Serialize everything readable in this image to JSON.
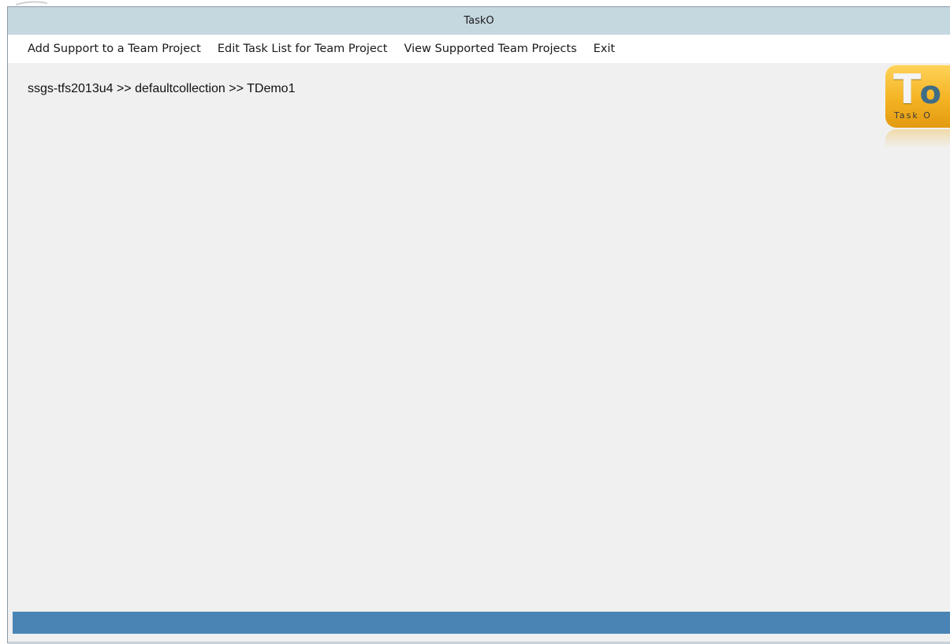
{
  "window": {
    "title": "TaskO"
  },
  "menu": {
    "items": [
      {
        "label": "Add Support to a Team Project"
      },
      {
        "label": "Edit Task List for Team Project"
      },
      {
        "label": "View Supported Team Projects"
      },
      {
        "label": "Exit"
      }
    ]
  },
  "breadcrumb": {
    "text": "ssgs-tfs2013u4 >> defaultcollection >> TDemo1"
  },
  "logo": {
    "letter_t": "T",
    "letter_o": "o",
    "caption": "Task O"
  },
  "colors": {
    "titlebar": "#c5d7df",
    "statusbar": "#4a84b4",
    "logo_gold": "#f4b323",
    "logo_blue": "#3f6d86"
  }
}
